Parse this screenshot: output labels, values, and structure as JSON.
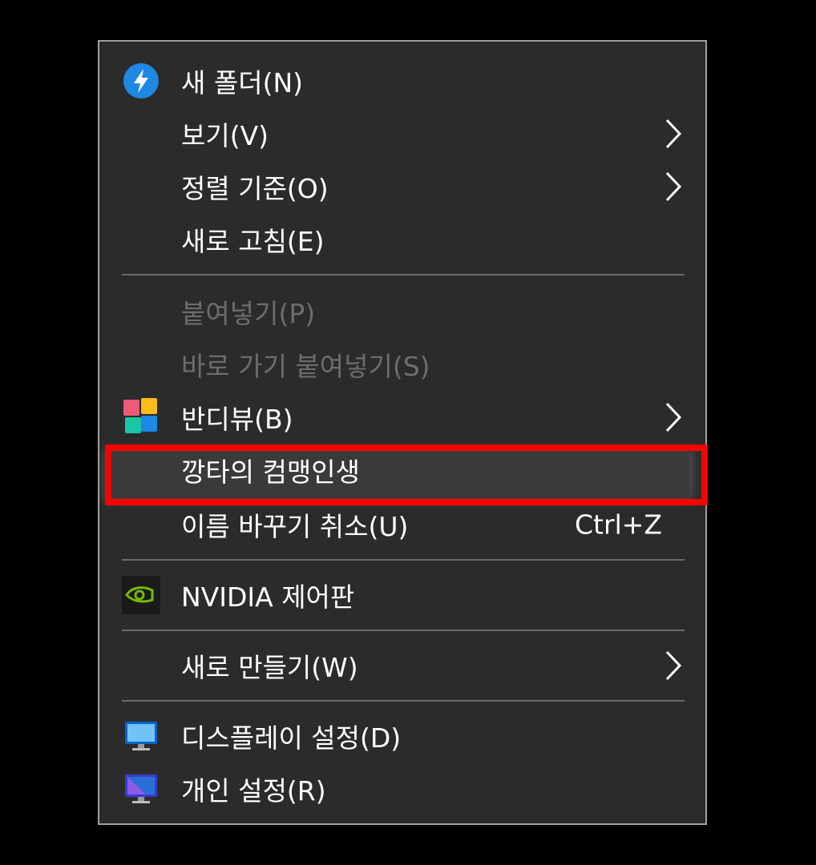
{
  "menu": {
    "items": [
      {
        "label": "새 폴더(N)",
        "icon": "blue-lightning-icon"
      },
      {
        "label": "보기(V)",
        "submenu": true
      },
      {
        "label": "정렬 기준(O)",
        "submenu": true
      },
      {
        "label": "새로 고침(E)"
      },
      {
        "label": "붙여넣기(P)",
        "disabled": true
      },
      {
        "label": "바로 가기 붙여넣기(S)",
        "disabled": true
      },
      {
        "label": "반디뷰(B)",
        "icon": "bandiview-icon",
        "submenu": true
      },
      {
        "label": "깡타의 컴맹인생",
        "highlighted": true
      },
      {
        "label": "이름 바꾸기 취소(U)",
        "shortcut": "Ctrl+Z"
      },
      {
        "label": "NVIDIA 제어판",
        "icon": "nvidia-icon"
      },
      {
        "label": "새로 만들기(W)",
        "submenu": true
      },
      {
        "label": "디스플레이 설정(D)",
        "icon": "display-settings-icon"
      },
      {
        "label": "개인 설정(R)",
        "icon": "personalize-icon"
      }
    ]
  },
  "colors": {
    "menu_bg": "#2b2b2b",
    "text": "#ffffff",
    "disabled_text": "#6d6d6d",
    "highlight_border": "#ff0000"
  }
}
